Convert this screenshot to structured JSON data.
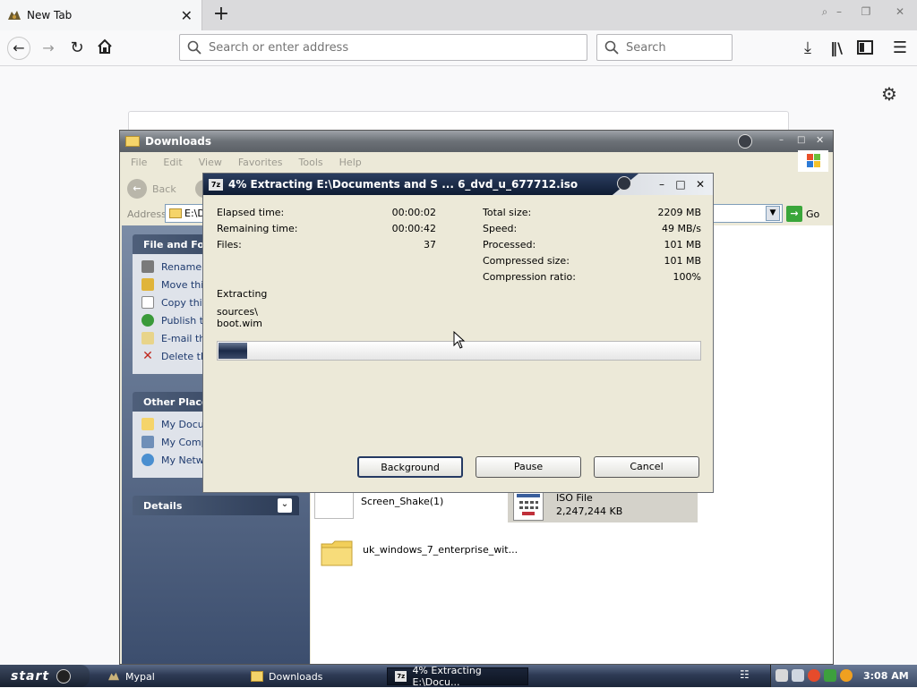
{
  "browser": {
    "tab_title": "New Tab",
    "url_placeholder": "Search or enter address",
    "search_placeholder": "Search"
  },
  "explorer": {
    "title": "Downloads",
    "menu": [
      "File",
      "Edit",
      "View",
      "Favorites",
      "Tools",
      "Help"
    ],
    "back_label": "Back",
    "address_label": "Address",
    "address_value": "E:\\D",
    "go_label": "Go",
    "file_folder_tasks": {
      "header": "File and Folc",
      "items": [
        "Rename",
        "Move thi",
        "Copy this",
        "Publish th",
        "E-mail th",
        "Delete th"
      ]
    },
    "other_places": {
      "header": "Other Places",
      "items": [
        "My Docu",
        "My Comp",
        "My Netw"
      ]
    },
    "details_header": "Details",
    "files": [
      {
        "name": "Screen_Shake(1)",
        "type": "",
        "size": ""
      },
      {
        "name": "",
        "type": "ISO File",
        "size": "2,247,244 KB"
      },
      {
        "name": "uk_windows_7_enterprise_wit...",
        "type": "",
        "size": ""
      }
    ]
  },
  "dialog": {
    "title": "4% Extracting E:\\Documents and S ... 6_dvd_u_677712.iso",
    "icon_text": "7z",
    "left_stats": [
      {
        "label": "Elapsed time:",
        "value": "00:00:02"
      },
      {
        "label": "Remaining time:",
        "value": "00:00:42"
      },
      {
        "label": "Files:",
        "value": "37"
      }
    ],
    "right_stats": [
      {
        "label": "Total size:",
        "value": "2209 MB"
      },
      {
        "label": "Speed:",
        "value": "49 MB/s"
      },
      {
        "label": "Processed:",
        "value": "101 MB"
      },
      {
        "label": "Compressed size:",
        "value": "101 MB"
      },
      {
        "label": "Compression ratio:",
        "value": "100%"
      }
    ],
    "status": "Extracting",
    "path_line1": "sources\\",
    "path_line2": "boot.wim",
    "progress_fraction": 0.06,
    "buttons": {
      "background": "Background",
      "pause": "Pause",
      "cancel": "Cancel"
    }
  },
  "taskbar": {
    "start_label": "start",
    "tasks": [
      "Mypal",
      "Downloads",
      "4% Extracting E:\\Docu..."
    ],
    "clock": "3:08 AM"
  }
}
